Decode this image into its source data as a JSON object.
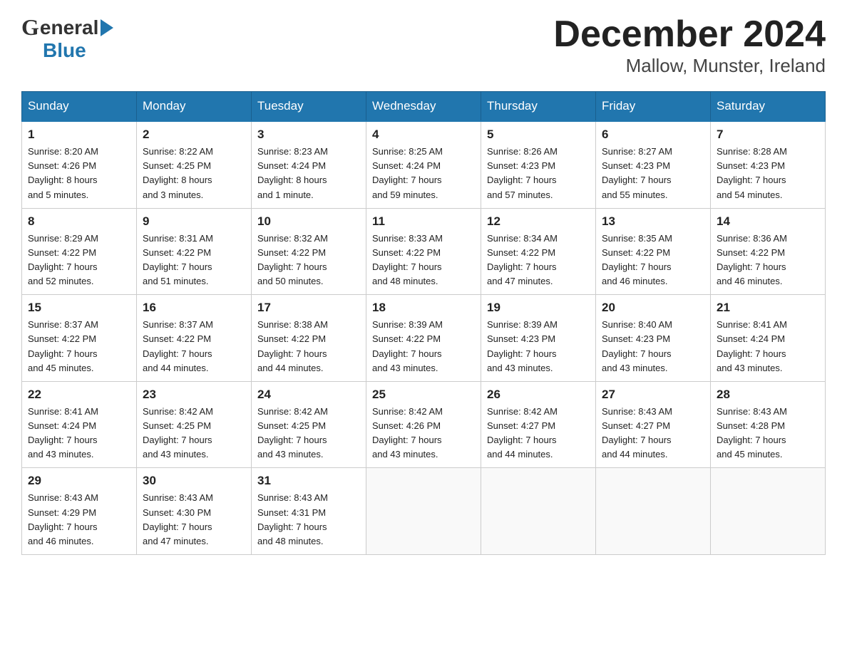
{
  "header": {
    "logo_line1": "General",
    "logo_line2": "Blue",
    "title": "December 2024",
    "subtitle": "Mallow, Munster, Ireland"
  },
  "calendar": {
    "days_of_week": [
      "Sunday",
      "Monday",
      "Tuesday",
      "Wednesday",
      "Thursday",
      "Friday",
      "Saturday"
    ],
    "weeks": [
      [
        {
          "day": "1",
          "info": "Sunrise: 8:20 AM\nSunset: 4:26 PM\nDaylight: 8 hours\nand 5 minutes."
        },
        {
          "day": "2",
          "info": "Sunrise: 8:22 AM\nSunset: 4:25 PM\nDaylight: 8 hours\nand 3 minutes."
        },
        {
          "day": "3",
          "info": "Sunrise: 8:23 AM\nSunset: 4:24 PM\nDaylight: 8 hours\nand 1 minute."
        },
        {
          "day": "4",
          "info": "Sunrise: 8:25 AM\nSunset: 4:24 PM\nDaylight: 7 hours\nand 59 minutes."
        },
        {
          "day": "5",
          "info": "Sunrise: 8:26 AM\nSunset: 4:23 PM\nDaylight: 7 hours\nand 57 minutes."
        },
        {
          "day": "6",
          "info": "Sunrise: 8:27 AM\nSunset: 4:23 PM\nDaylight: 7 hours\nand 55 minutes."
        },
        {
          "day": "7",
          "info": "Sunrise: 8:28 AM\nSunset: 4:23 PM\nDaylight: 7 hours\nand 54 minutes."
        }
      ],
      [
        {
          "day": "8",
          "info": "Sunrise: 8:29 AM\nSunset: 4:22 PM\nDaylight: 7 hours\nand 52 minutes."
        },
        {
          "day": "9",
          "info": "Sunrise: 8:31 AM\nSunset: 4:22 PM\nDaylight: 7 hours\nand 51 minutes."
        },
        {
          "day": "10",
          "info": "Sunrise: 8:32 AM\nSunset: 4:22 PM\nDaylight: 7 hours\nand 50 minutes."
        },
        {
          "day": "11",
          "info": "Sunrise: 8:33 AM\nSunset: 4:22 PM\nDaylight: 7 hours\nand 48 minutes."
        },
        {
          "day": "12",
          "info": "Sunrise: 8:34 AM\nSunset: 4:22 PM\nDaylight: 7 hours\nand 47 minutes."
        },
        {
          "day": "13",
          "info": "Sunrise: 8:35 AM\nSunset: 4:22 PM\nDaylight: 7 hours\nand 46 minutes."
        },
        {
          "day": "14",
          "info": "Sunrise: 8:36 AM\nSunset: 4:22 PM\nDaylight: 7 hours\nand 46 minutes."
        }
      ],
      [
        {
          "day": "15",
          "info": "Sunrise: 8:37 AM\nSunset: 4:22 PM\nDaylight: 7 hours\nand 45 minutes."
        },
        {
          "day": "16",
          "info": "Sunrise: 8:37 AM\nSunset: 4:22 PM\nDaylight: 7 hours\nand 44 minutes."
        },
        {
          "day": "17",
          "info": "Sunrise: 8:38 AM\nSunset: 4:22 PM\nDaylight: 7 hours\nand 44 minutes."
        },
        {
          "day": "18",
          "info": "Sunrise: 8:39 AM\nSunset: 4:22 PM\nDaylight: 7 hours\nand 43 minutes."
        },
        {
          "day": "19",
          "info": "Sunrise: 8:39 AM\nSunset: 4:23 PM\nDaylight: 7 hours\nand 43 minutes."
        },
        {
          "day": "20",
          "info": "Sunrise: 8:40 AM\nSunset: 4:23 PM\nDaylight: 7 hours\nand 43 minutes."
        },
        {
          "day": "21",
          "info": "Sunrise: 8:41 AM\nSunset: 4:24 PM\nDaylight: 7 hours\nand 43 minutes."
        }
      ],
      [
        {
          "day": "22",
          "info": "Sunrise: 8:41 AM\nSunset: 4:24 PM\nDaylight: 7 hours\nand 43 minutes."
        },
        {
          "day": "23",
          "info": "Sunrise: 8:42 AM\nSunset: 4:25 PM\nDaylight: 7 hours\nand 43 minutes."
        },
        {
          "day": "24",
          "info": "Sunrise: 8:42 AM\nSunset: 4:25 PM\nDaylight: 7 hours\nand 43 minutes."
        },
        {
          "day": "25",
          "info": "Sunrise: 8:42 AM\nSunset: 4:26 PM\nDaylight: 7 hours\nand 43 minutes."
        },
        {
          "day": "26",
          "info": "Sunrise: 8:42 AM\nSunset: 4:27 PM\nDaylight: 7 hours\nand 44 minutes."
        },
        {
          "day": "27",
          "info": "Sunrise: 8:43 AM\nSunset: 4:27 PM\nDaylight: 7 hours\nand 44 minutes."
        },
        {
          "day": "28",
          "info": "Sunrise: 8:43 AM\nSunset: 4:28 PM\nDaylight: 7 hours\nand 45 minutes."
        }
      ],
      [
        {
          "day": "29",
          "info": "Sunrise: 8:43 AM\nSunset: 4:29 PM\nDaylight: 7 hours\nand 46 minutes."
        },
        {
          "day": "30",
          "info": "Sunrise: 8:43 AM\nSunset: 4:30 PM\nDaylight: 7 hours\nand 47 minutes."
        },
        {
          "day": "31",
          "info": "Sunrise: 8:43 AM\nSunset: 4:31 PM\nDaylight: 7 hours\nand 48 minutes."
        },
        {
          "day": "",
          "info": ""
        },
        {
          "day": "",
          "info": ""
        },
        {
          "day": "",
          "info": ""
        },
        {
          "day": "",
          "info": ""
        }
      ]
    ]
  }
}
